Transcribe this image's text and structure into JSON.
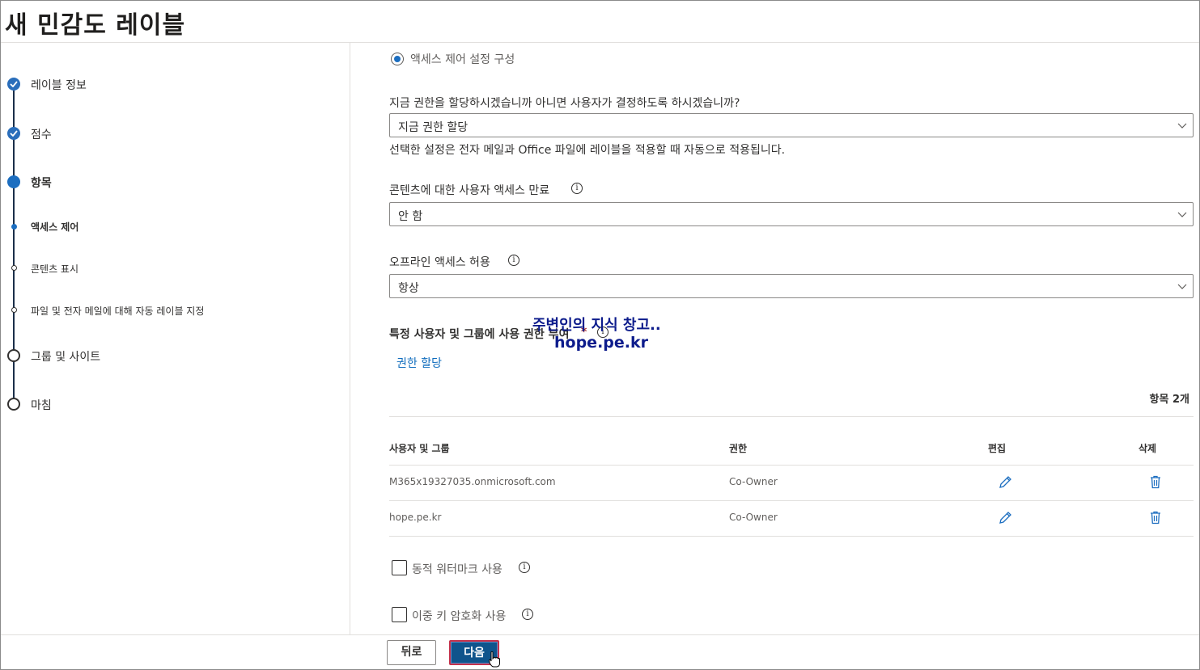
{
  "window": {
    "title": "새 민감도 레이블"
  },
  "stepper": {
    "steps": [
      {
        "label": "레이블 정보",
        "state": "done"
      },
      {
        "label": "점수",
        "state": "done"
      },
      {
        "label": "항목",
        "state": "current"
      },
      {
        "label": "액세스 제어",
        "state": "current-sub"
      },
      {
        "label": "콘텐츠 표시",
        "state": "pending-sub"
      },
      {
        "label": "파일 및 전자 메일에 대해 자동 레이블 지정",
        "state": "pending-sub"
      },
      {
        "label": "그룹 및 사이트",
        "state": "pending"
      },
      {
        "label": "마침",
        "state": "pending"
      }
    ]
  },
  "main": {
    "radio_label": "액세스 제어 설정 구성",
    "assign_question": "지금 권한을 할당하시겠습니까 아니면 사용자가 결정하도록 하시겠습니까?",
    "assign_select": "지금 권한 할당",
    "assign_help": "선택한 설정은 전자 메일과 Office 파일에 레이블을 적용할 때 자동으로 적용됩니다.",
    "expire_label": "콘텐츠에 대한 사용자 액세스 만료",
    "expire_select": "안 함",
    "offline_label": "오프라인 액세스 허용",
    "offline_select": "항상",
    "permissions_label": "특정 사용자 및 그룹에 사용 권한 부여",
    "required_mark": "*",
    "assign_link": "권한 할당",
    "item_count": "항목 2개",
    "table": {
      "headers": {
        "users": "사용자 및 그룹",
        "perm": "권한",
        "edit": "편집",
        "delete": "삭제"
      },
      "rows": [
        {
          "user": "M365x19327035.onmicrosoft.com",
          "perm": "Co-Owner"
        },
        {
          "user": "hope.pe.kr",
          "perm": "Co-Owner"
        }
      ]
    },
    "watermark_checkbox": "동적 워터마크 사용",
    "doublekey_checkbox": "이중 키 암호화 사용"
  },
  "overlay": {
    "line1": "주변인의 지식 창고..",
    "line2": "hope.pe.kr"
  },
  "footer": {
    "back": "뒤로",
    "next": "다음"
  },
  "colors": {
    "accent": "#0f548c",
    "link": "#0f6cbd",
    "stepper": "#1c6ec0",
    "watermark": "#0d1c8c"
  }
}
